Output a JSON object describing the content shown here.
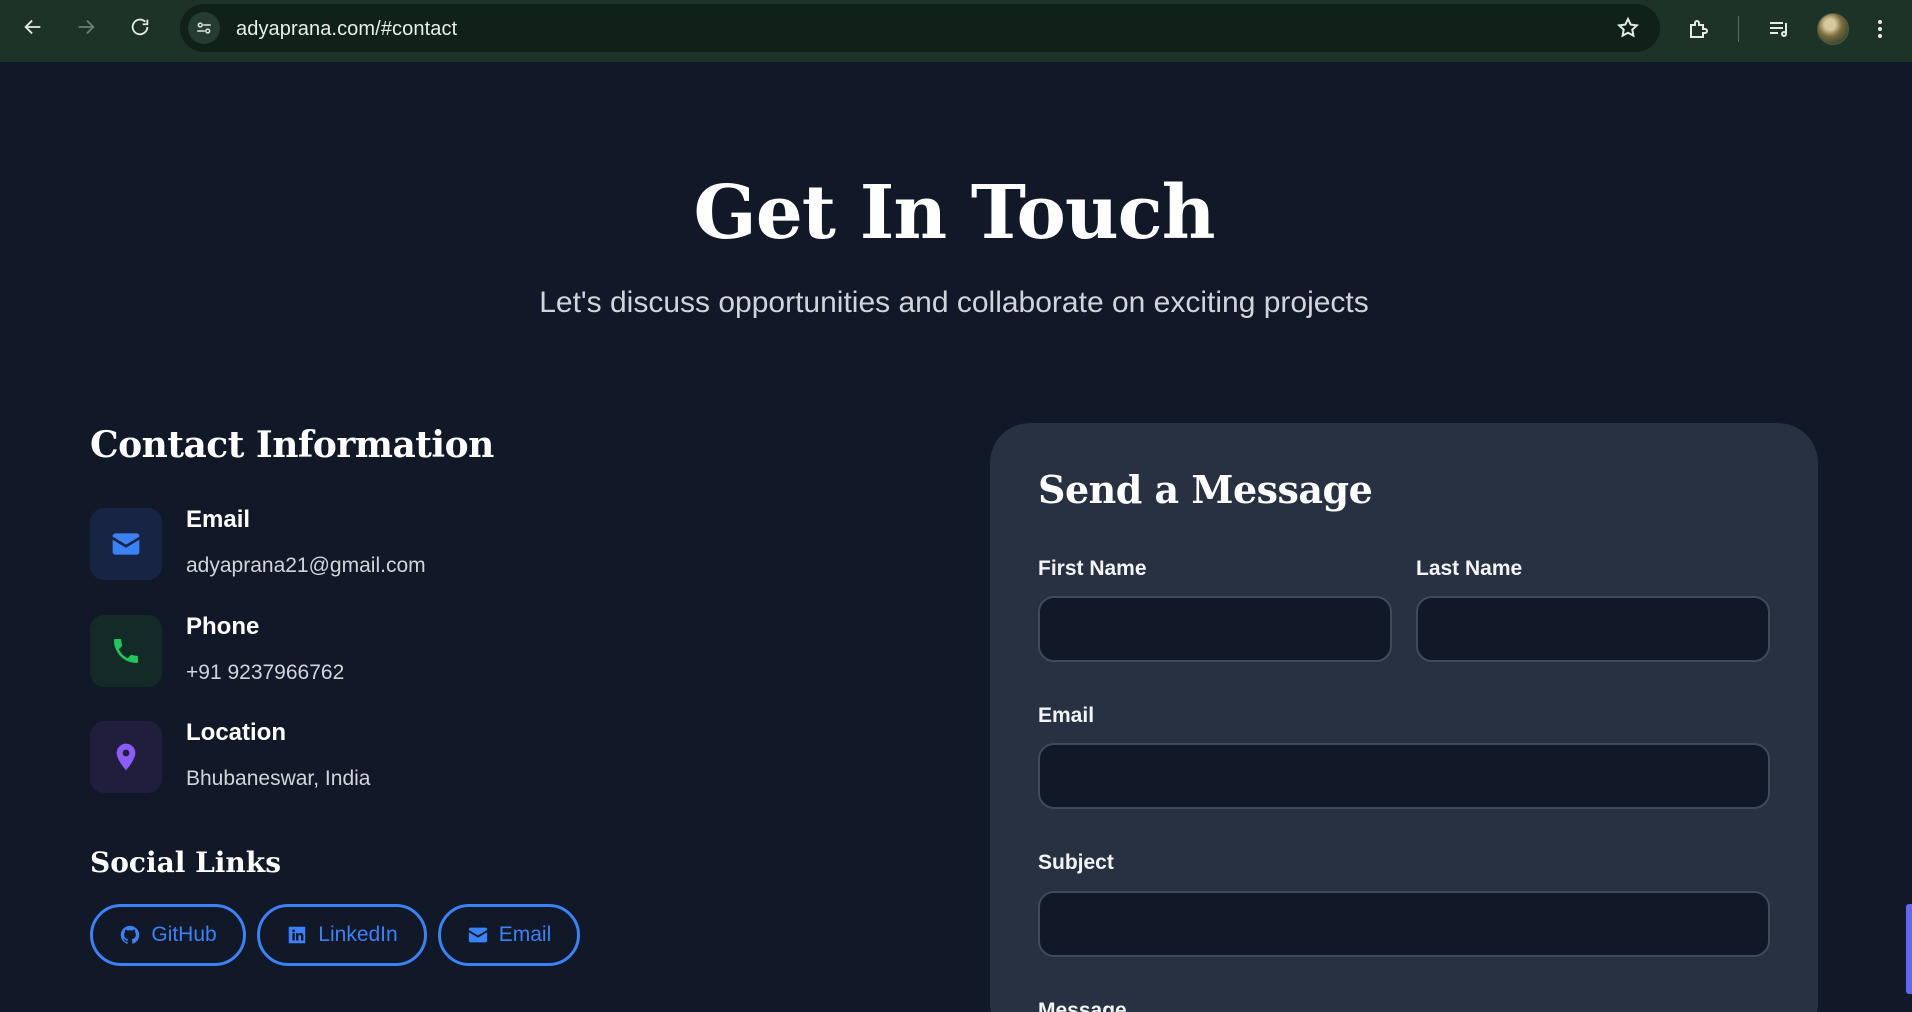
{
  "browser": {
    "url": "adyaprana.com/#contact",
    "icons": [
      "back-arrow-icon",
      "forward-arrow-icon",
      "reload-icon",
      "site-settings-icon",
      "star-icon",
      "extensions-icon",
      "media-queue-icon",
      "profile-avatar",
      "more-vert-icon"
    ]
  },
  "hero": {
    "title": "Get In Touch",
    "subtitle": "Let's discuss opportunities and collaborate on exciting projects"
  },
  "contact": {
    "heading": "Contact Information",
    "items": [
      {
        "label": "Email",
        "value": "adyaprana21@gmail.com",
        "icon": "envelope-icon",
        "color": "#3b82f6"
      },
      {
        "label": "Phone",
        "value": "+91 9237966762",
        "icon": "phone-icon",
        "color": "#22c55e"
      },
      {
        "label": "Location",
        "value": "Bhubaneswar, India",
        "icon": "map-pin-icon",
        "color": "#8b5cf6"
      }
    ]
  },
  "social": {
    "heading": "Social Links",
    "links": [
      {
        "label": "GitHub",
        "icon": "github-icon"
      },
      {
        "label": "LinkedIn",
        "icon": "linkedin-icon"
      },
      {
        "label": "Email",
        "icon": "envelope-icon"
      }
    ]
  },
  "form": {
    "title": "Send a Message",
    "first_name_label": "First Name",
    "first_name_value": "",
    "last_name_label": "Last Name",
    "last_name_value": "",
    "email_label": "Email",
    "email_value": "",
    "subject_label": "Subject",
    "subject_value": "",
    "message_label": "Message"
  },
  "colors": {
    "page_bg": "#111827",
    "card_bg": "#283141",
    "accent": "#3b82f6",
    "browser_bar": "#1d3328"
  }
}
